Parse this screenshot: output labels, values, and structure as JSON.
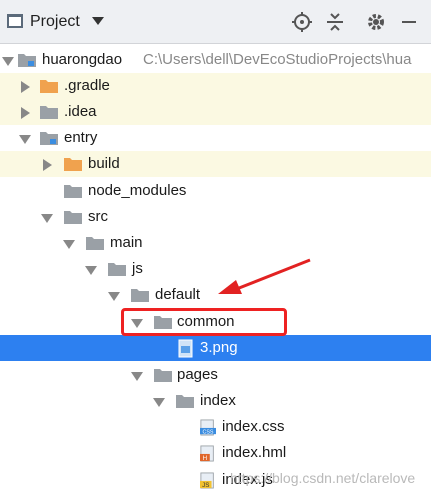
{
  "header": {
    "title": "Project",
    "icons": [
      "project-icon",
      "locate-icon",
      "collapse-icon",
      "gear-icon",
      "minimize-icon"
    ]
  },
  "tree": [
    {
      "label": "huarongdao",
      "path": "C:\\Users\\dell\\DevEcoStudioProjects\\hua"
    },
    {
      "label": ".gradle"
    },
    {
      "label": ".idea"
    },
    {
      "label": "entry"
    },
    {
      "label": "build"
    },
    {
      "label": "node_modules"
    },
    {
      "label": "src"
    },
    {
      "label": "main"
    },
    {
      "label": "js"
    },
    {
      "label": "default"
    },
    {
      "label": "common"
    },
    {
      "label": "3.png"
    },
    {
      "label": "pages"
    },
    {
      "label": "index"
    },
    {
      "label": "index.css"
    },
    {
      "label": "index.hml"
    },
    {
      "label": "index.js"
    }
  ],
  "badges": {
    "css": "CSS",
    "hml": "H",
    "js": "JS"
  },
  "watermark": "https://blog.csdn.net/clarelove",
  "colors": {
    "selection": "#2d80f0",
    "highlight": "#fbf9e2",
    "annotation": "#e22222",
    "folder_orange": "#f0a24e",
    "folder_gray": "#9aa0a6"
  }
}
